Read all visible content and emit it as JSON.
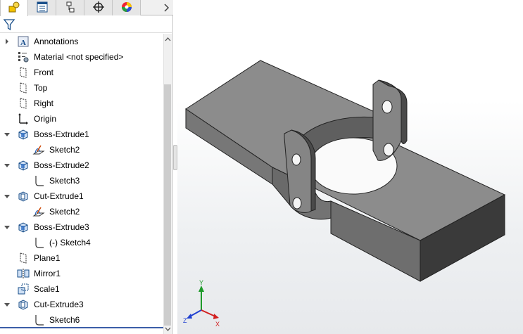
{
  "tabs": [
    {
      "name": "display-manager",
      "icon": "display-manager-icon",
      "active": true
    },
    {
      "name": "feature-manager",
      "icon": "feature-tree-icon",
      "active": false
    },
    {
      "name": "configuration-manager",
      "icon": "configuration-icon",
      "active": false
    },
    {
      "name": "dim-xpert",
      "icon": "crosshair-icon",
      "active": false
    },
    {
      "name": "appearance",
      "icon": "appearance-ball-icon",
      "active": false
    }
  ],
  "more_tabs_icon": "chevron-right-icon",
  "filter_icon": "filter-icon",
  "tree": {
    "items": [
      {
        "label": "Annotations",
        "icon": "annotations-icon",
        "indent": 0,
        "expander": "collapsed"
      },
      {
        "label": "Material <not specified>",
        "icon": "material-icon",
        "indent": 0,
        "expander": "none"
      },
      {
        "label": "Front",
        "icon": "plane-icon",
        "indent": 0,
        "expander": "none"
      },
      {
        "label": "Top",
        "icon": "plane-icon",
        "indent": 0,
        "expander": "none"
      },
      {
        "label": "Right",
        "icon": "plane-icon",
        "indent": 0,
        "expander": "none"
      },
      {
        "label": "Origin",
        "icon": "origin-icon",
        "indent": 0,
        "expander": "none"
      },
      {
        "label": "Boss-Extrude1",
        "icon": "boss-extrude-icon",
        "indent": 0,
        "expander": "expanded"
      },
      {
        "label": "Sketch2",
        "icon": "sketch-icon",
        "indent": 1,
        "expander": "none"
      },
      {
        "label": "Boss-Extrude2",
        "icon": "boss-extrude-icon",
        "indent": 0,
        "expander": "expanded"
      },
      {
        "label": "Sketch3",
        "icon": "sketch-profile-icon",
        "indent": 1,
        "expander": "none"
      },
      {
        "label": "Cut-Extrude1",
        "icon": "cut-extrude-icon",
        "indent": 0,
        "expander": "expanded"
      },
      {
        "label": "Sketch2",
        "icon": "sketch-icon",
        "indent": 1,
        "expander": "none"
      },
      {
        "label": "Boss-Extrude3",
        "icon": "boss-extrude-icon",
        "indent": 0,
        "expander": "expanded"
      },
      {
        "label": "(-) Sketch4",
        "icon": "sketch-profile-icon",
        "indent": 1,
        "expander": "none"
      },
      {
        "label": "Plane1",
        "icon": "plane-icon",
        "indent": 0,
        "expander": "none"
      },
      {
        "label": "Mirror1",
        "icon": "mirror-icon",
        "indent": 0,
        "expander": "none"
      },
      {
        "label": "Scale1",
        "icon": "scale-icon",
        "indent": 0,
        "expander": "none"
      },
      {
        "label": "Cut-Extrude3",
        "icon": "cut-extrude-icon",
        "indent": 0,
        "expander": "expanded"
      },
      {
        "label": "Sketch6",
        "icon": "sketch-profile-icon",
        "indent": 1,
        "expander": "none"
      }
    ]
  },
  "triad": {
    "x_label": "X",
    "y_label": "Y",
    "z_label": "Z"
  },
  "colors": {
    "axis_x": "#d22020",
    "axis_y": "#1e9a2a",
    "axis_z": "#2040d0",
    "part_top": "#8c8c8c",
    "part_front": "#6a6a6a",
    "part_side": "#3a3a3a",
    "selection_bar": "#3c5ea8"
  }
}
